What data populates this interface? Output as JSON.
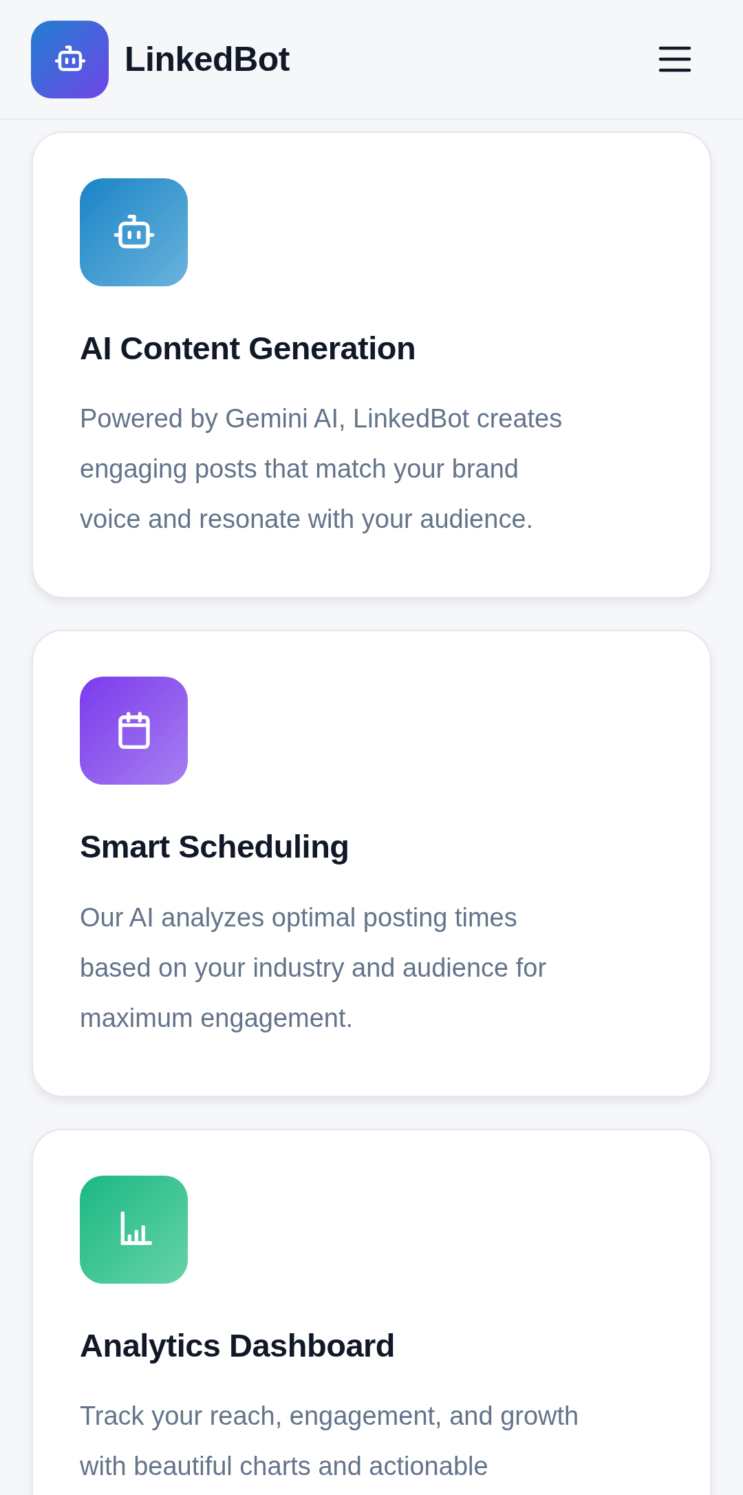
{
  "header": {
    "brand": "LinkedBot"
  },
  "features": [
    {
      "kind": "robot",
      "title": "AI Content Generation",
      "lines": [
        "Powered by Gemini AI, LinkedBot creates",
        "engaging posts that match your brand",
        "voice and resonate with your audience."
      ]
    },
    {
      "kind": "calendar",
      "title": "Smart Scheduling",
      "lines": [
        "Our AI analyzes optimal posting times",
        "based on your industry and audience for",
        "maximum engagement."
      ]
    },
    {
      "kind": "chart",
      "title": "Analytics Dashboard",
      "lines": [
        "Track your reach, engagement, and growth",
        "with beautiful charts and actionable"
      ]
    }
  ]
}
